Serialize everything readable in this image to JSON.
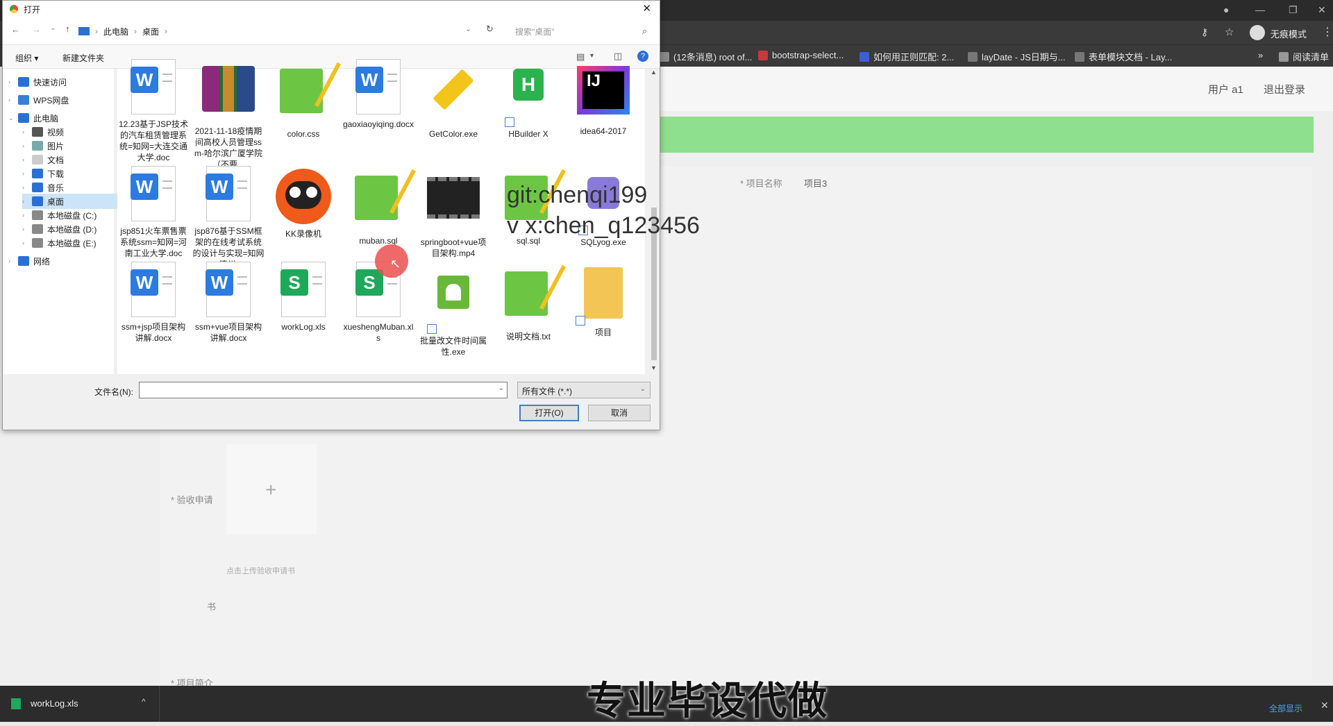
{
  "browser": {
    "bookmarks": [
      "(12条消息) root of...",
      "bootstrap-select...",
      "如何用正则匹配: 2...",
      "layDate - JS日期与...",
      "表单模块文档 - Lay..."
    ],
    "more": "»",
    "reading_list": "阅读清单",
    "incognito": "无痕模式"
  },
  "page": {
    "user": "用户 a1",
    "logout": "退出登录",
    "project_name_label": "* 项目名称",
    "project_name_value": "项目3",
    "acceptance_label": "* 验收申请",
    "upload_hint": "点击上传验收申请书",
    "book_char": "书",
    "intro_label": "* 项目简介"
  },
  "dialog": {
    "title": "打开",
    "breadcrumb": [
      "此电脑",
      "桌面"
    ],
    "search_placeholder": "搜索\"桌面\"",
    "organize": "组织 ▾",
    "new_folder": "新建文件夹",
    "tree": [
      {
        "label": "快速访问",
        "icon": "star-icon",
        "level": 0
      },
      {
        "label": "WPS网盘",
        "icon": "cloud-icon",
        "level": 0
      },
      {
        "label": "此电脑",
        "icon": "computer-icon",
        "level": 0,
        "expanded": true
      },
      {
        "label": "视频",
        "icon": "video-folder-icon",
        "level": 1
      },
      {
        "label": "图片",
        "icon": "pictures-folder-icon",
        "level": 1
      },
      {
        "label": "文档",
        "icon": "documents-folder-icon",
        "level": 1
      },
      {
        "label": "下载",
        "icon": "download-folder-icon",
        "level": 1
      },
      {
        "label": "音乐",
        "icon": "music-folder-icon",
        "level": 1
      },
      {
        "label": "桌面",
        "icon": "desktop-folder-icon",
        "level": 1,
        "selected": true
      },
      {
        "label": "本地磁盘 (C:)",
        "icon": "drive-icon",
        "level": 1
      },
      {
        "label": "本地磁盘 (D:)",
        "icon": "drive-icon",
        "level": 1
      },
      {
        "label": "本地磁盘 (E:)",
        "icon": "drive-icon",
        "level": 1
      },
      {
        "label": "网络",
        "icon": "network-icon",
        "level": 0
      }
    ],
    "files": [
      {
        "name": "12.23基于JSP技术的汽车租赁管理系统=知网=大连交通大学.doc",
        "icon": "word-icon"
      },
      {
        "name": "2021-11-18疫情期间高校人员管理ssm-哈尔滨广厦学院（不要...",
        "icon": "rar-icon"
      },
      {
        "name": "color.css",
        "icon": "notepadpp-icon"
      },
      {
        "name": "gaoxiaoyiqing.docx",
        "icon": "word-icon"
      },
      {
        "name": "GetColor.exe",
        "icon": "color-picker-icon"
      },
      {
        "name": "HBuilder X",
        "icon": "hbuilder-icon"
      },
      {
        "name": "idea64-2017",
        "icon": "intellij-icon"
      },
      {
        "name": "jsp851火车票售票系统ssm=知网=河南工业大学.doc",
        "icon": "word-icon"
      },
      {
        "name": "jsp876基于SSM框架的在线考试系统的设计与实现=知网=德州...",
        "icon": "word-icon"
      },
      {
        "name": "KK录像机",
        "icon": "kk-recorder-icon"
      },
      {
        "name": "muban.sql",
        "icon": "notepadpp-icon"
      },
      {
        "name": "springboot+vue项目架构.mp4",
        "icon": "video-file-icon"
      },
      {
        "name": "sql.sql",
        "icon": "notepadpp-icon"
      },
      {
        "name": "SQLyog.exe",
        "icon": "sqlyog-icon"
      },
      {
        "name": "ssm+jsp项目架构讲解.docx",
        "icon": "word-icon"
      },
      {
        "name": "ssm+vue项目架构讲解.docx",
        "icon": "word-icon"
      },
      {
        "name": "workLog.xls",
        "icon": "wps-sheet-icon"
      },
      {
        "name": "xueshengMuban.xls",
        "icon": "wps-sheet-icon"
      },
      {
        "name": "批量改文件时间属性.exe",
        "icon": "android-icon"
      },
      {
        "name": "说明文档.txt",
        "icon": "notepadpp-icon"
      },
      {
        "name": "项目",
        "icon": "folder-icon"
      }
    ],
    "filename_label": "文件名(N):",
    "filename_value": "",
    "filetype": "所有文件 (*.*)",
    "open_button": "打开(O)",
    "cancel_button": "取消"
  },
  "overlay": {
    "git": "git:chenqi199",
    "vx": "v x:chen_q123456",
    "watermark": "专业毕设代做"
  },
  "taskbar": {
    "download_item": "workLog.xls",
    "show_all": "全部显示"
  }
}
